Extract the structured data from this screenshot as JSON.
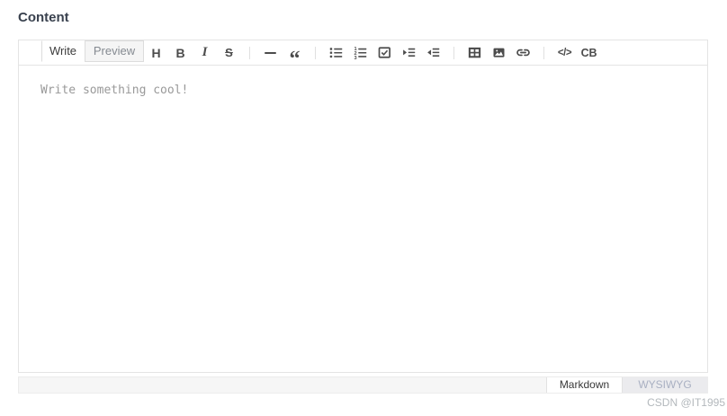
{
  "title": "Content",
  "tabs": [
    {
      "label": "Write",
      "active": true
    },
    {
      "label": "Preview",
      "active": false
    }
  ],
  "toolbar": [
    {
      "name": "heading",
      "glyph": "H"
    },
    {
      "name": "bold",
      "glyph": "B"
    },
    {
      "name": "italic",
      "glyph": "I"
    },
    {
      "name": "strikethrough",
      "glyph": "S"
    },
    {
      "name": "horizontal-rule"
    },
    {
      "name": "blockquote",
      "glyph": "“"
    },
    {
      "name": "unordered-list"
    },
    {
      "name": "ordered-list"
    },
    {
      "name": "task-list"
    },
    {
      "name": "indent"
    },
    {
      "name": "outdent"
    },
    {
      "name": "table"
    },
    {
      "name": "image"
    },
    {
      "name": "link"
    },
    {
      "name": "inline-code",
      "glyph": "</>"
    },
    {
      "name": "code-block",
      "glyph": "CB"
    }
  ],
  "content": {
    "placeholder": "Write something cool!"
  },
  "mode_switch": [
    {
      "label": "Markdown",
      "active": true
    },
    {
      "label": "WYSIWYG",
      "active": false
    }
  ],
  "watermark": "CSDN @IT1995",
  "colors": {
    "border": "#e4e4e4",
    "icon": "#4c4c4c",
    "placeholder_text": "#999999",
    "inactive_tab_bg": "#f5f5f5",
    "mode_bar_bg": "#f6f6f6",
    "wysiwyg_text": "#a9b0c2",
    "title_text": "#39414e"
  }
}
